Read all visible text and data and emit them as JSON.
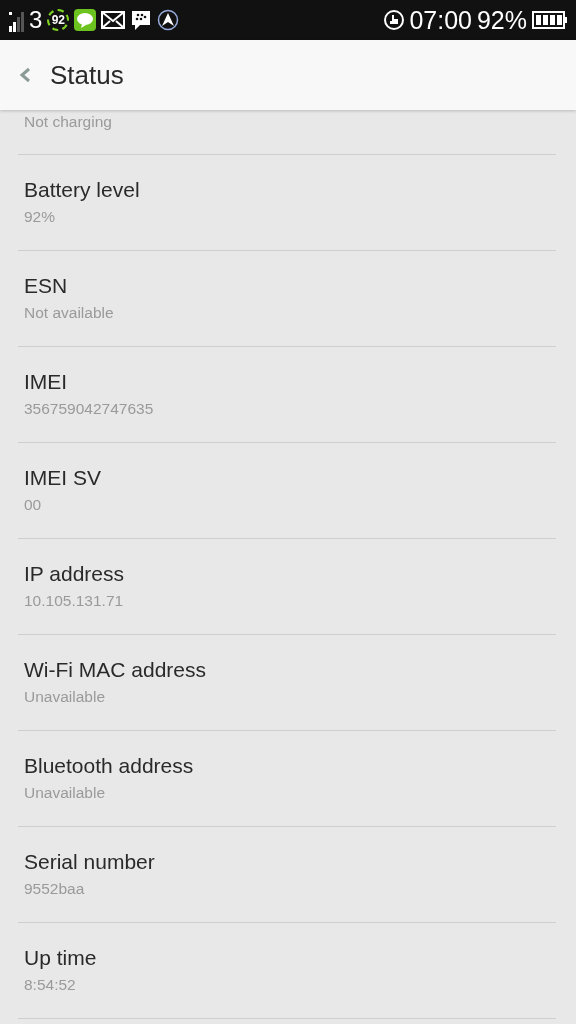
{
  "status_bar": {
    "network": "3",
    "badge": "92",
    "time": "07:00",
    "battery": "92%"
  },
  "header": {
    "title": "Status"
  },
  "items": [
    {
      "value": "Not charging"
    },
    {
      "title": "Battery level",
      "value": "92%"
    },
    {
      "title": "ESN",
      "value": "Not available"
    },
    {
      "title": "IMEI",
      "value": "356759042747635"
    },
    {
      "title": "IMEI SV",
      "value": "00"
    },
    {
      "title": "IP address",
      "value": "10.105.131.71"
    },
    {
      "title": "Wi-Fi MAC address",
      "value": "Unavailable"
    },
    {
      "title": "Bluetooth address",
      "value": "Unavailable"
    },
    {
      "title": "Serial number",
      "value": "9552baa"
    },
    {
      "title": "Up time",
      "value": "8:54:52"
    }
  ]
}
